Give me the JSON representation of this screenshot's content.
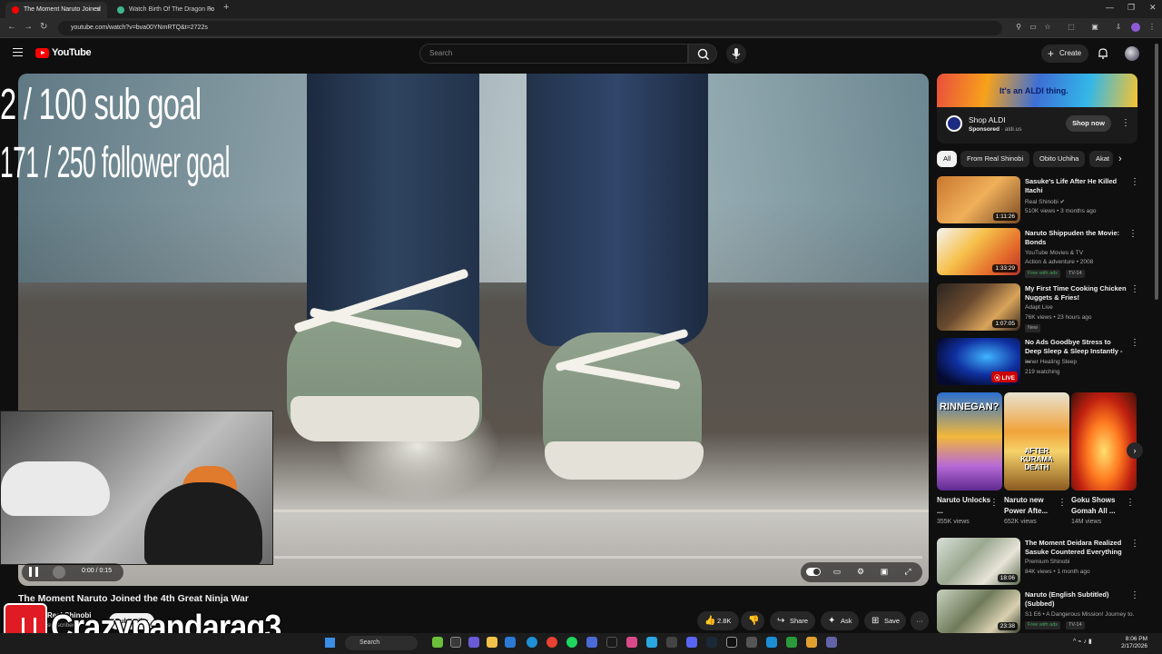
{
  "browser": {
    "tabs": [
      {
        "title": "The Moment Naruto Joined",
        "active": true
      },
      {
        "title": "Watch Birth Of The Dragon Fo",
        "active": false
      }
    ],
    "new_tab": "+",
    "url": "youtube.com/watch?v=bva00YNmRTQ&t=2722s"
  },
  "youtube": {
    "logo_text": "YouTube",
    "search_placeholder": "Search",
    "create_label": "Create"
  },
  "player": {
    "overlay_sub_goal": "2  / 100 sub goal",
    "overlay_follower_goal": "171 / 250 follower goal",
    "time": "0:00 / 0:15",
    "progress": 0
  },
  "video": {
    "title": "The Moment Naruto Joined the 4th Great Ninja War",
    "channel": "Real Shinobi",
    "subs": "subscribers",
    "subscribe_label": "Subscribe",
    "stream_overlay_name": "Crazypandarag3",
    "like_count": "2.8K",
    "share_label": "Share",
    "ask_label": "Ask",
    "save_label": "Save"
  },
  "ad": {
    "slogan": "It's an ALDI thing.",
    "title": "Shop ALDI",
    "sponsored": "Sponsored",
    "domain": "aldi.us",
    "cta": "Shop now"
  },
  "chips": [
    "All",
    "From Real Shinobi",
    "Obito Uchiha",
    "Akat"
  ],
  "recommendations": [
    {
      "title": "Sasuke's Life After He Killed Itachi",
      "channel": "Real Shinobi",
      "meta": "510K views • 3 months ago",
      "duration": "1:11:26"
    },
    {
      "title": "Naruto Shippuden the Movie: Bonds",
      "channel": "YouTube Movies & TV",
      "meta": "Action & adventure • 2008",
      "duration": "1:33:29",
      "badge1": "Free with ads",
      "badge2": "TV-14"
    },
    {
      "title": "My First Time Cooking Chicken Nuggets & Fries!",
      "channel": "Adapt Live",
      "meta": "76K views • 23 hours ago",
      "duration": "1:07:05",
      "badge1": "New"
    },
    {
      "title": "No Ads Goodbye Stress to Deep Sleep & Sleep Instantly - ...",
      "channel": "Inner Healing Sleep",
      "meta": "219 watching",
      "live": "LIVE"
    },
    {
      "title": "The Moment Deidara Realized Sasuke Countered Everything",
      "channel": "Premium Shinobi",
      "meta": "84K views • 1 month ago",
      "duration": "18:06"
    },
    {
      "title": "Naruto (English Subtitled) (Subbed)",
      "channel": "S1 E6 • A Dangerous Mission! Journey to...",
      "duration": "23:38",
      "badge1": "Free with ads",
      "badge2": "TV-14"
    }
  ],
  "shorts": [
    {
      "title": "Naruto Unlocks ...",
      "views": "355K views",
      "caption": "RINNEGAN?"
    },
    {
      "title": "Naruto new Power Afte...",
      "views": "652K views",
      "caption": "AFTER KURAMA DEATH"
    },
    {
      "title": "Goku Shows Gomah All ...",
      "views": "14M views"
    }
  ],
  "taskbar": {
    "search": "Search",
    "time": "8:06 PM",
    "date": "2/17/2026"
  },
  "colors": {
    "background": "#0f0f0f",
    "brand_red": "#ff0000",
    "chip_bg": "#272727"
  }
}
